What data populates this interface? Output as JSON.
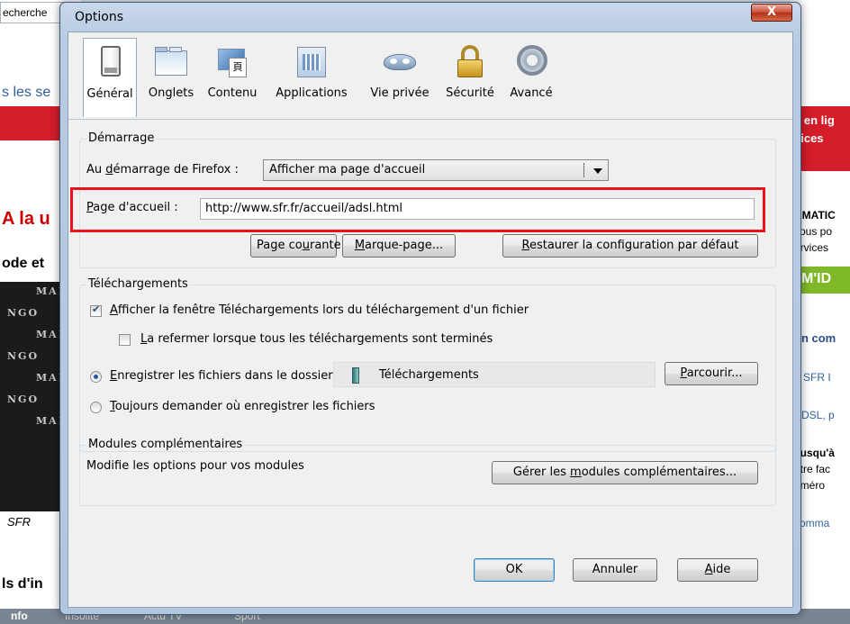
{
  "background": {
    "search_text": "echerche",
    "left_texts": [
      "s les se",
      "A la u",
      "ode et",
      "SFR",
      "ls d'in"
    ],
    "right_texts": [
      "e en lig",
      "vices",
      "RMATIC",
      "vous po",
      "ervices",
      "on com",
      "à SFR I",
      "ADSL, p",
      "Jusqu'à",
      "otre fac",
      "uméro",
      "comma"
    ],
    "green_badge": "M'ID",
    "dark_rows": [
      "MAN",
      "NGO",
      "MAN",
      "NGO",
      "MAN",
      "NGO",
      "MAN"
    ],
    "bottom_tabs": [
      "nfo",
      "Insolite",
      "Actu TV",
      "Sport"
    ]
  },
  "window": {
    "title": "Options",
    "close_label": "X"
  },
  "toolbar": {
    "items": [
      {
        "label": "Général",
        "icon": "switch-icon"
      },
      {
        "label": "Onglets",
        "icon": "tabs-icon"
      },
      {
        "label": "Contenu",
        "icon": "content-icon"
      },
      {
        "label": "Applications",
        "icon": "applications-icon"
      },
      {
        "label": "Vie privée",
        "icon": "privacy-mask-icon"
      },
      {
        "label": "Sécurité",
        "icon": "padlock-icon"
      },
      {
        "label": "Avancé",
        "icon": "gear-icon"
      }
    ],
    "selected": "Général"
  },
  "startup": {
    "title": "Démarrage",
    "startup_label_pre": "Au ",
    "startup_label_u": "d",
    "startup_label_post": "émarrage de Firefox :",
    "startup_value": "Afficher ma page d'accueil",
    "homepage_label_u": "P",
    "homepage_label_post": "age d'accueil :",
    "homepage_value": "http://www.sfr.fr/accueil/adsl.html",
    "btn_current_pre": "Page co",
    "btn_current_u": "u",
    "btn_current_post": "rante",
    "btn_bookmark_u": "M",
    "btn_bookmark_post": "arque-page...",
    "btn_restore_u": "R",
    "btn_restore_post": "estaurer la configuration par défaut"
  },
  "downloads": {
    "title": "Téléchargements",
    "show_window_u": "A",
    "show_window_post": "fficher la fenêtre Téléchargements lors du téléchargement d'un fichier",
    "close_when_done_u": "L",
    "close_when_done_post": "a refermer lorsque tous les téléchargements sont terminés",
    "save_to_u": "E",
    "save_to_post": "nregistrer les fichiers dans le dossier",
    "folder_name": "Téléchargements",
    "browse_u": "P",
    "browse_post": "arcourir...",
    "always_ask_u": "T",
    "always_ask_post": "oujours demander où enregistrer les fichiers",
    "show_window_checked": true,
    "close_when_done_checked": false,
    "save_to_selected": true
  },
  "addons": {
    "title": "Modules complémentaires",
    "description": "Modifie les options pour vos modules",
    "manage_pre": "Gérer les ",
    "manage_u": "m",
    "manage_post": "odules complémentaires..."
  },
  "footer": {
    "ok": "OK",
    "cancel": "Annuler",
    "help_u": "A",
    "help_post": "ide"
  },
  "colors": {
    "highlight": "#e8131b",
    "close_button": "#c8523c",
    "window_frame": "#b8cbe2"
  }
}
